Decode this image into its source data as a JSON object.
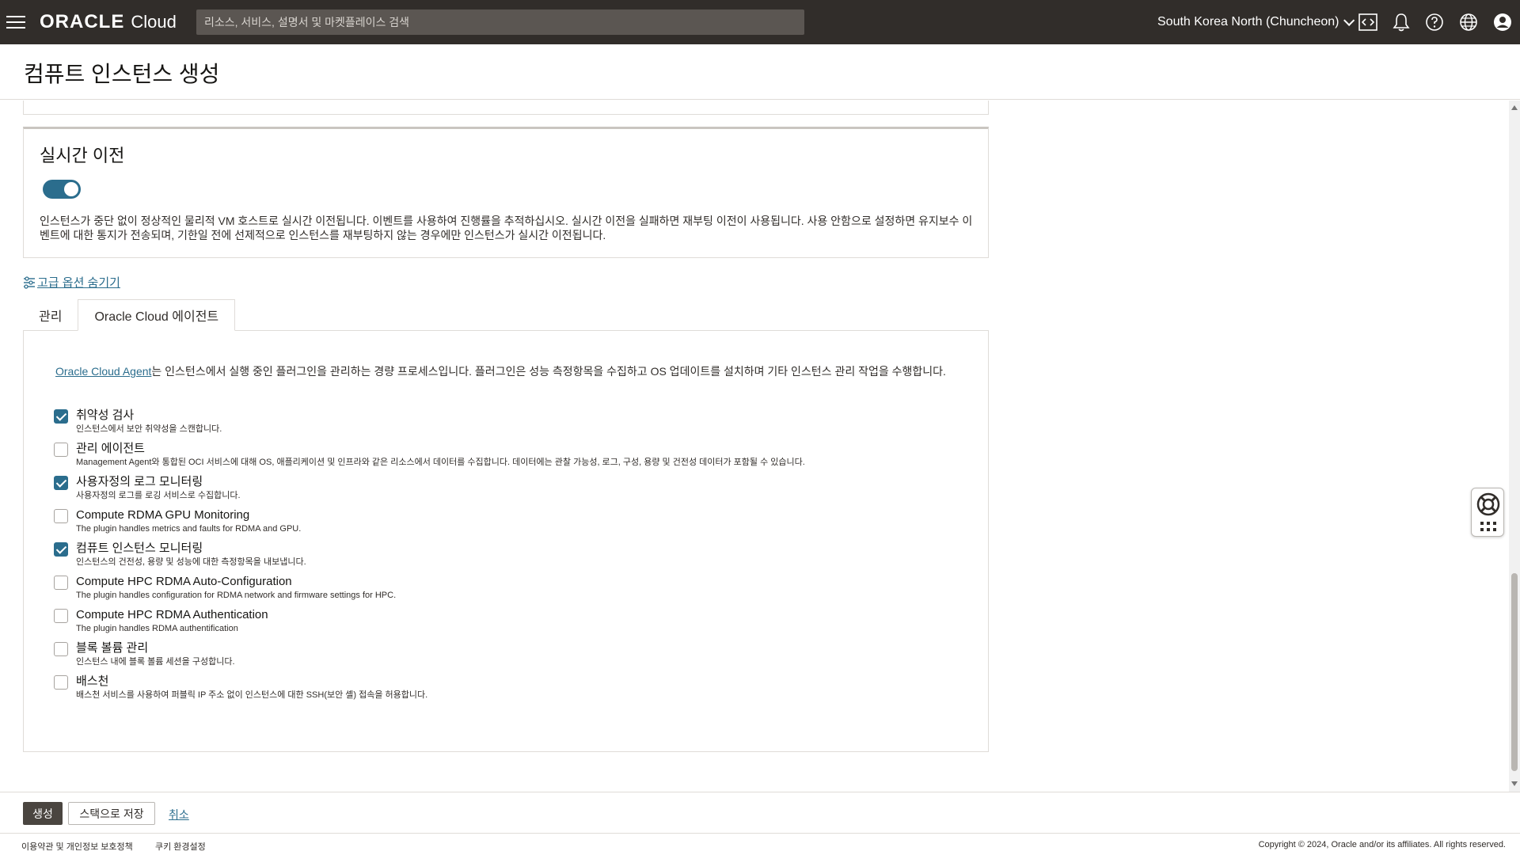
{
  "topbar": {
    "brand_oracle": "ORACLE",
    "brand_cloud": "Cloud",
    "search_placeholder": "리소스, 서비스, 설명서 및 마켓플레이스 검색",
    "region": "South Korea North (Chuncheon)",
    "icons": [
      "code-editor-icon",
      "bell-icon",
      "help-icon",
      "globe-icon",
      "user-icon"
    ]
  },
  "page": {
    "title": "컴퓨트 인스턴스 생성"
  },
  "live_migration": {
    "heading": "실시간 이전",
    "toggle_on": true,
    "description": "인스턴스가 중단 없이 정상적인 물리적 VM 호스트로 실시간 이전됩니다. 이벤트를 사용하여 진행률을 추적하십시오. 실시간 이전을 실패하면 재부팅 이전이 사용됩니다. 사용 안함으로 설정하면 유지보수 이벤트에 대한 통지가 전송되며, 기한일 전에 선제적으로 인스턴스를 재부팅하지 않는 경우에만 인스턴스가 실시간 이전됩니다."
  },
  "advanced": {
    "hide_link": "고급 옵션 숨기기",
    "tabs": [
      {
        "label": "관리",
        "active": false
      },
      {
        "label": "Oracle Cloud 에이전트",
        "active": true
      }
    ]
  },
  "agent": {
    "intro_link": "Oracle Cloud Agent",
    "intro_text": "는 인스턴스에서 실행 중인 플러그인을 관리하는 경량 프로세스입니다. 플러그인은 성능 측정항목을 수집하고 OS 업데이트를 설치하며 기타 인스턴스 관리 작업을 수행합니다.",
    "plugins": [
      {
        "name": "취약성 검사",
        "desc": "인스턴스에서 보안 취약성을 스캔합니다.",
        "checked": true
      },
      {
        "name": "관리 에이전트",
        "desc": "Management Agent와 통합된 OCI 서비스에 대해 OS, 애플리케이션 및 인프라와 같은 리소스에서 데이터를 수집합니다. 데이터에는 관찰 가능성, 로그, 구성, 용량 및 건전성 데이터가 포함될 수 있습니다.",
        "checked": false
      },
      {
        "name": "사용자정의 로그 모니터링",
        "desc": "사용자정의 로그를 로깅 서비스로 수집합니다.",
        "checked": true
      },
      {
        "name": "Compute RDMA GPU Monitoring",
        "desc": "The plugin handles metrics and faults for RDMA and GPU.",
        "checked": false
      },
      {
        "name": "컴퓨트 인스턴스 모니터링",
        "desc": "인스턴스의 건전성, 용량 및 성능에 대한 측정항목을 내보냅니다.",
        "checked": true
      },
      {
        "name": "Compute HPC RDMA Auto-Configuration",
        "desc": "The plugin handles configuration for RDMA network and firmware settings for HPC.",
        "checked": false
      },
      {
        "name": "Compute HPC RDMA Authentication",
        "desc": "The plugin handles RDMA authentification",
        "checked": false
      },
      {
        "name": "블록 볼륨 관리",
        "desc": "인스턴스 내에 블록 볼륨 세션을 구성합니다.",
        "checked": false
      },
      {
        "name": "배스천",
        "desc": "배스천 서비스를 사용하여 퍼블릭 IP 주소 없이 인스턴스에 대한 SSH(보안 셸) 접속을 허용합니다.",
        "checked": false
      }
    ]
  },
  "actions": {
    "create": "생성",
    "save_stack": "스택으로 저장",
    "cancel": "취소"
  },
  "footer": {
    "terms": "이용약관 및 개인정보 보호정책",
    "cookies": "쿠키 환경설정",
    "copyright": "Copyright © 2024, Oracle and/or its affiliates. All rights reserved."
  },
  "colors": {
    "topbar_bg": "#312d2a",
    "accent": "#2b6d8d",
    "primary_button": "#4a4540"
  }
}
